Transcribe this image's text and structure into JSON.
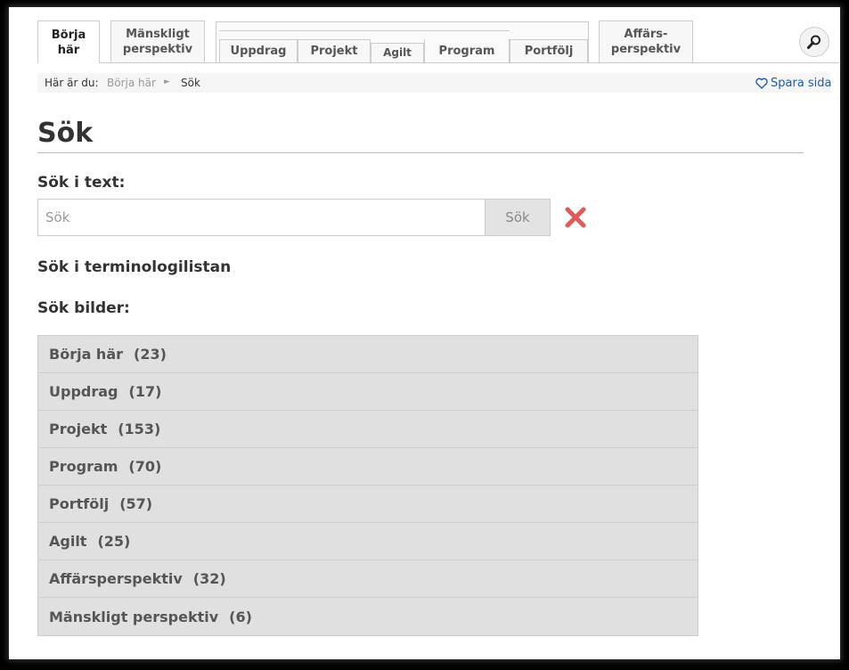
{
  "tabs": {
    "borja_har": [
      "Börja",
      "här"
    ],
    "manskligt": [
      "Mänskligt",
      "perspektiv"
    ],
    "uppdrag": "Uppdrag",
    "projekt": "Projekt",
    "agilt": "Agilt",
    "program": "Program",
    "portfolj": "Portfölj",
    "affars": [
      "Affärs-",
      "perspektiv"
    ]
  },
  "breadcrumb": {
    "label": "Här är du:",
    "items": [
      "Börja här",
      "Sök"
    ],
    "separator": "►"
  },
  "save_page": "Spara sida",
  "page_title": "Sök",
  "search_text": {
    "heading": "Sök i text:",
    "placeholder": "Sök",
    "value": "",
    "button": "Sök"
  },
  "terminology_link": "Sök i terminologilistan",
  "images_heading": "Sök bilder:",
  "categories": [
    {
      "name": "Börja här",
      "count": "(23)"
    },
    {
      "name": "Uppdrag",
      "count": "(17)"
    },
    {
      "name": "Projekt",
      "count": "(153)"
    },
    {
      "name": "Program",
      "count": "(70)"
    },
    {
      "name": "Portfölj",
      "count": "(57)"
    },
    {
      "name": "Agilt",
      "count": "(25)"
    },
    {
      "name": "Affärsperspektiv",
      "count": "(32)"
    },
    {
      "name": "Mänskligt perspektiv",
      "count": "(6)"
    }
  ],
  "icons": {
    "search": "magnifier-icon",
    "heart": "heart-icon",
    "clear": "close-x-icon"
  },
  "colors": {
    "link": "#1f5aa6",
    "clear_x": "#e05a5a",
    "category_bg": "#e0e0e0"
  }
}
